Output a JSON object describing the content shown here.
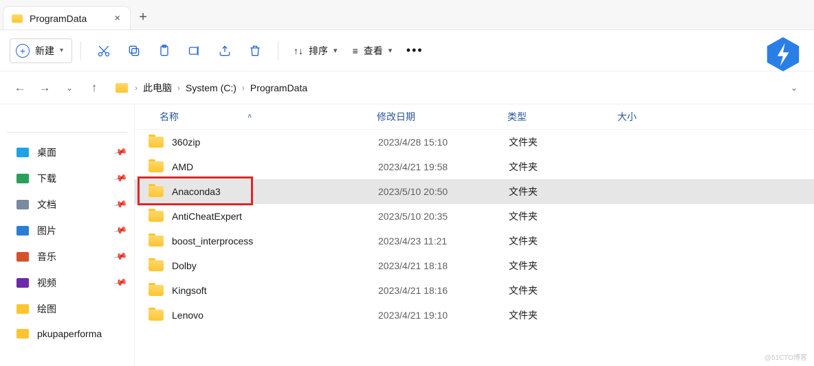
{
  "tab": {
    "title": "ProgramData"
  },
  "toolbar": {
    "new_label": "新建",
    "sort_label": "排序",
    "view_label": "查看"
  },
  "breadcrumbs": [
    "此电脑",
    "System (C:)",
    "ProgramData"
  ],
  "columns": {
    "name": "名称",
    "date": "修改日期",
    "type": "类型",
    "size": "大小"
  },
  "sidebar": [
    {
      "label": "桌面",
      "color": "#1fa3e6"
    },
    {
      "label": "下载",
      "color": "#2aa05a"
    },
    {
      "label": "文档",
      "color": "#7a8aa0"
    },
    {
      "label": "图片",
      "color": "#2a7fd4"
    },
    {
      "label": "音乐",
      "color": "#d4522a"
    },
    {
      "label": "视频",
      "color": "#6b2aa8"
    },
    {
      "label": "绘图",
      "color": "#ffc531"
    },
    {
      "label": "pkupaperforma",
      "color": "#ffc531"
    }
  ],
  "rows": [
    {
      "name": "360zip",
      "date": "2023/4/28 15:10",
      "type": "文件夹",
      "selected": false
    },
    {
      "name": "AMD",
      "date": "2023/4/21 19:58",
      "type": "文件夹",
      "selected": false
    },
    {
      "name": "Anaconda3",
      "date": "2023/5/10 20:50",
      "type": "文件夹",
      "selected": true
    },
    {
      "name": "AntiCheatExpert",
      "date": "2023/5/10 20:35",
      "type": "文件夹",
      "selected": false
    },
    {
      "name": "boost_interprocess",
      "date": "2023/4/23 11:21",
      "type": "文件夹",
      "selected": false
    },
    {
      "name": "Dolby",
      "date": "2023/4/21 18:18",
      "type": "文件夹",
      "selected": false
    },
    {
      "name": "Kingsoft",
      "date": "2023/4/21 18:16",
      "type": "文件夹",
      "selected": false
    },
    {
      "name": "Lenovo",
      "date": "2023/4/21 19:10",
      "type": "文件夹",
      "selected": false
    }
  ],
  "highlight_row_index": 2,
  "watermark": "@51CTO博客"
}
